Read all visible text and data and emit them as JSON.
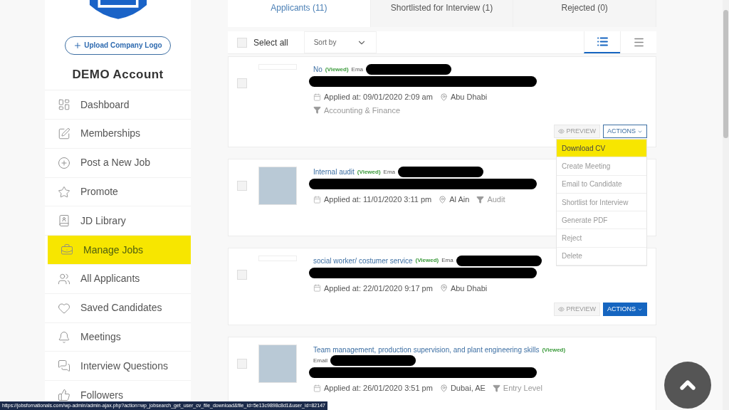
{
  "sidebar": {
    "upload_button": "Upload Company Logo",
    "account_name": "DEMO Account",
    "items": [
      {
        "label": "Dashboard",
        "selected": false
      },
      {
        "label": "Memberships",
        "selected": false
      },
      {
        "label": "Post a New Job",
        "selected": false
      },
      {
        "label": "Promote",
        "selected": false
      },
      {
        "label": "JD Library",
        "selected": false
      },
      {
        "label": "Manage Jobs",
        "selected": true
      },
      {
        "label": "All Applicants",
        "selected": false
      },
      {
        "label": "Saved Candidates",
        "selected": false
      },
      {
        "label": "Meetings",
        "selected": false
      },
      {
        "label": "Interview Questions",
        "selected": false
      },
      {
        "label": "Followers",
        "selected": false
      }
    ]
  },
  "tabs": [
    {
      "label": "Applicants (11)",
      "selected": true
    },
    {
      "label": "Shortlisted for Interview (1)",
      "selected": false
    },
    {
      "label": "Rejected (0)",
      "selected": false
    }
  ],
  "toolbar": {
    "select_all": "Select all",
    "checked": false,
    "sort_placeholder": "Sort by",
    "views": [
      {
        "kind": "list",
        "selected": true
      },
      {
        "kind": "lines",
        "selected": false
      }
    ]
  },
  "applicants": [
    {
      "title": "No",
      "viewed": "(Viewed)",
      "email_label": "Ema",
      "photo": false,
      "checked": false,
      "applied": "Applied at: 09/01/2020 2:09 am",
      "location": "Abu Dhabi",
      "category": "Accounting & Finance",
      "preview": "PREVIEW",
      "actions": "ACTIONS",
      "actions_open": true
    },
    {
      "title": "Internal audit",
      "viewed": "(Viewed)",
      "email_label": "Ema",
      "photo": true,
      "checked": false,
      "applied": "Applied at: 11/01/2020 3:11 pm",
      "location": "Al Ain",
      "category": "Audit"
    },
    {
      "title": "social worker/ costumer service",
      "viewed": "(Viewed)",
      "email_label": "Ema",
      "photo": false,
      "checked": false,
      "applied": "Applied at: 22/01/2020 9:17 pm",
      "location": "Abu Dhabi",
      "preview": "PREVIEW",
      "actions": "ACTIONS",
      "actions_open": false
    },
    {
      "title": "Team management, production supervision, and plant engineering skills",
      "viewed": "(Viewed)",
      "email_label": "Email",
      "photo": true,
      "checked": false,
      "applied": "Applied at: 26/01/2020 3:51 pm",
      "location": "Dubai, AE",
      "category": "Entry Level"
    }
  ],
  "actions_menu": [
    {
      "label": "Download CV",
      "selected": true
    },
    {
      "label": "Create Meeting",
      "selected": false
    },
    {
      "label": "Email to Candidate",
      "selected": false
    },
    {
      "label": "Shortlist for Interview",
      "selected": false
    },
    {
      "label": "Generate PDF",
      "selected": false
    },
    {
      "label": "Reject",
      "selected": false
    },
    {
      "label": "Delete",
      "selected": false
    }
  ],
  "status_bar": "https://jobsfornationals.com/wp-admin/admin-ajax.php?action=wp_jobsearch_get_user_cv_file_download&file_id=5e13c9898c8d1&user_id=82147"
}
